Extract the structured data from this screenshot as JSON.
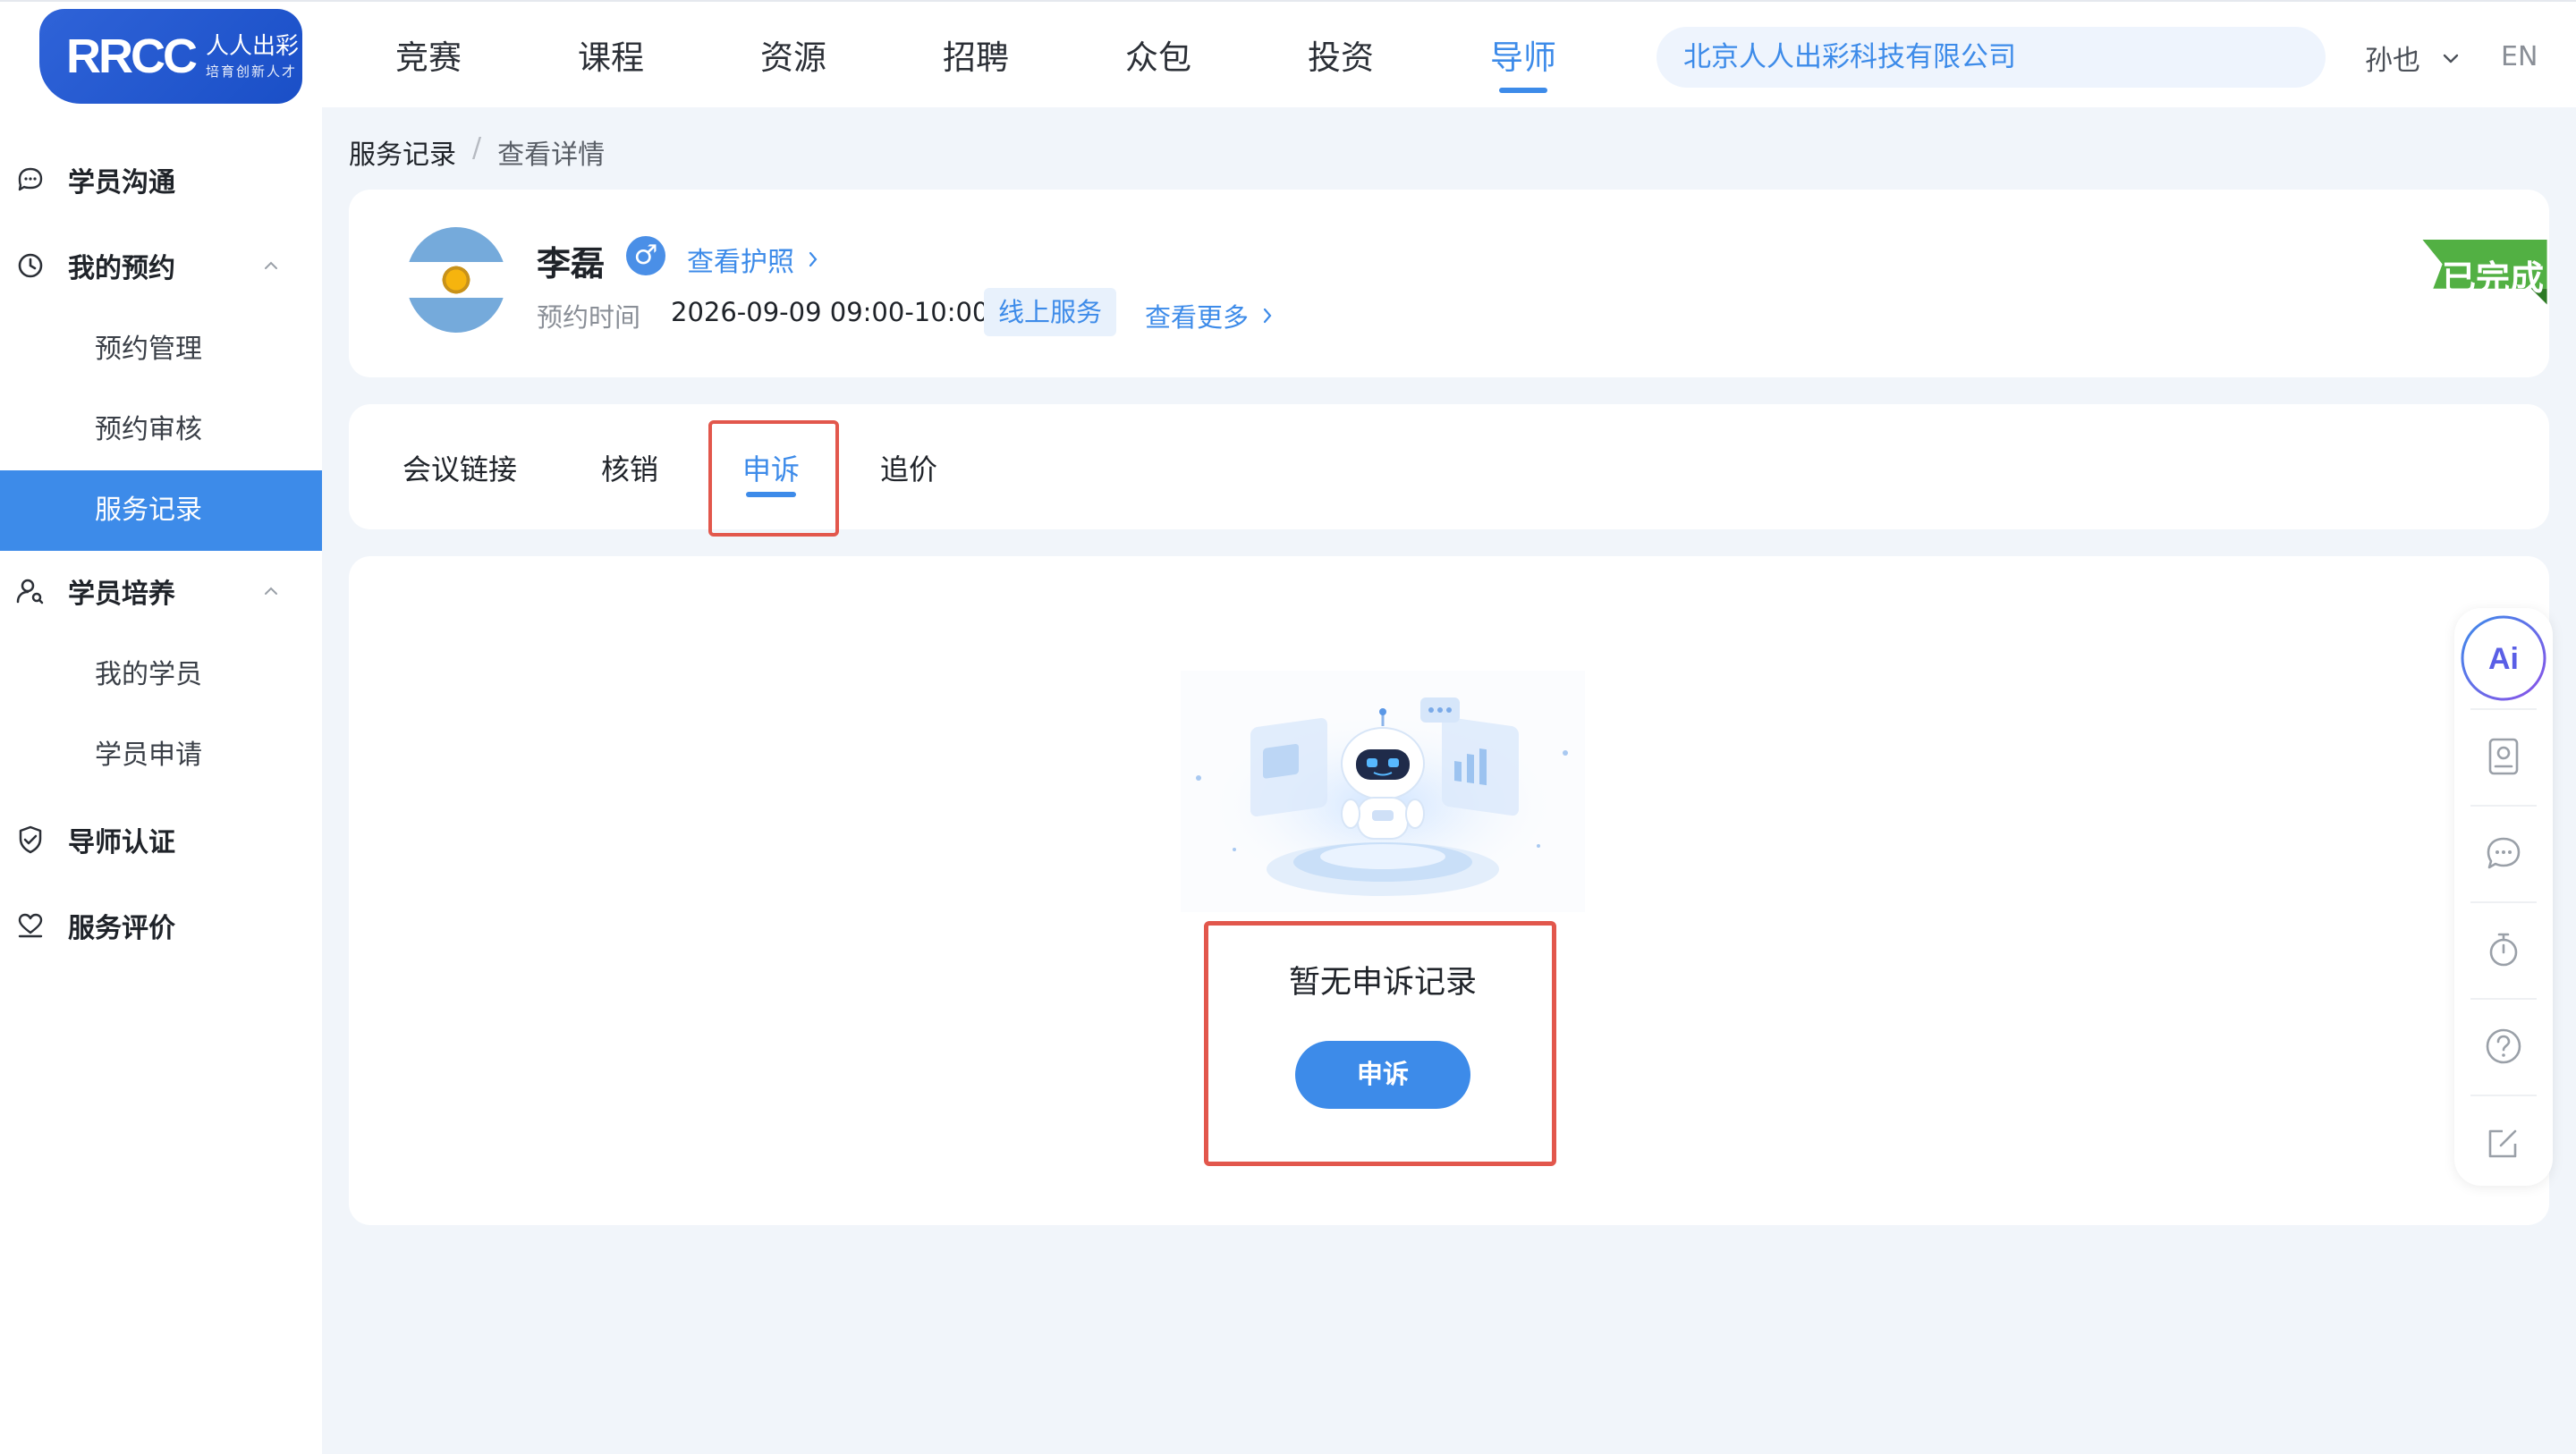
{
  "header": {
    "logo": {
      "main": "RRCC",
      "cn": "人人出彩",
      "sub": "培育创新人才"
    },
    "nav": [
      "竞赛",
      "课程",
      "资源",
      "招聘",
      "众包",
      "投资",
      "导师"
    ],
    "active_nav": "导师",
    "company": "北京人人出彩科技有限公司",
    "user": "孙也",
    "lang": "EN"
  },
  "sidebar": {
    "items": [
      {
        "label": "学员沟通"
      },
      {
        "label": "我的预约",
        "children": [
          "预约管理",
          "预约审核",
          "服务记录"
        ]
      },
      {
        "label": "学员培养",
        "children": [
          "我的学员",
          "学员申请"
        ]
      },
      {
        "label": "导师认证"
      },
      {
        "label": "服务评价"
      }
    ],
    "active_child": "服务记录"
  },
  "breadcrumb": {
    "parent": "服务记录",
    "sep": "/",
    "current": "查看详情"
  },
  "profile": {
    "name": "李磊",
    "gender_symbol": "♂",
    "passport_link": "查看护照",
    "appt_label": "预约时间",
    "appt_time": "2026-09-09 09:00-10:00",
    "service_tag": "线上服务",
    "more_link": "查看更多",
    "status": "已完成"
  },
  "tabs": [
    "会议链接",
    "核销",
    "申诉",
    "追价"
  ],
  "active_tab": "申诉",
  "empty": {
    "text": "暂无申诉记录",
    "button": "申诉"
  },
  "float_bar": {
    "ai_label": "Ai"
  },
  "colors": {
    "accent": "#3d8be9",
    "highlight": "#e2574c",
    "done": "#52b043"
  }
}
